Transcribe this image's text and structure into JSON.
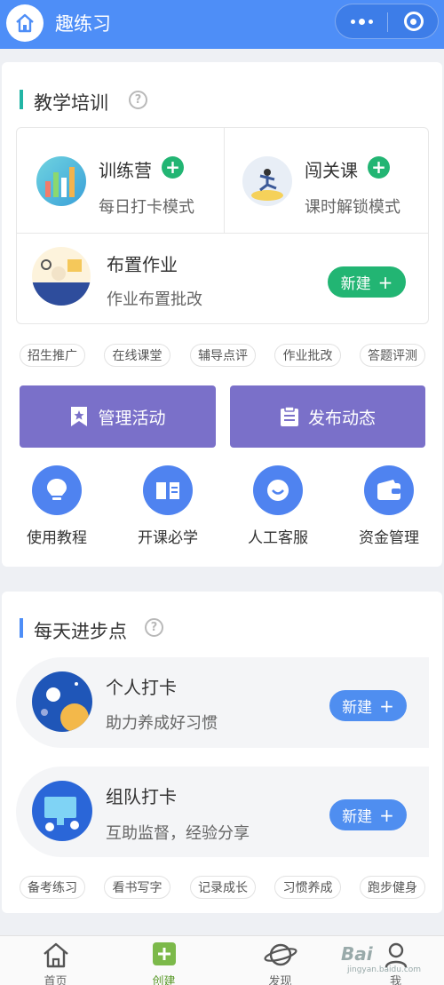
{
  "header": {
    "title": "趣练习"
  },
  "teaching": {
    "title": "教学培训",
    "help": "?",
    "camp": {
      "title": "训练营",
      "sub": "每日打卡模式"
    },
    "course": {
      "title": "闯关课",
      "sub": "课时解锁模式"
    },
    "homework": {
      "title": "布置作业",
      "sub": "作业布置批改",
      "button": "新建"
    },
    "tags": [
      "招生推广",
      "在线课堂",
      "辅导点评",
      "作业批改",
      "答题评测"
    ],
    "manage_label": "管理活动",
    "publish_label": "发布动态",
    "tools": [
      "使用教程",
      "开课必学",
      "人工客服",
      "资金管理"
    ]
  },
  "daily": {
    "title": "每天进步点",
    "help": "?",
    "personal": {
      "title": "个人打卡",
      "sub": "助力养成好习惯",
      "button": "新建"
    },
    "team": {
      "title": "组队打卡",
      "sub": "互助监督，经验分享",
      "button": "新建"
    },
    "tags": [
      "备考练习",
      "看书写字",
      "记录成长",
      "习惯养成",
      "跑步健身"
    ]
  },
  "tabbar": {
    "home": "首页",
    "create": "创建",
    "discover": "发现",
    "me": "我"
  },
  "watermark": {
    "main": "Bai",
    "sub": "jingyan.baidu.com"
  },
  "colors": {
    "primary": "#4e8ef7",
    "green": "#22b573",
    "purple": "#7a70c9",
    "blue_btn": "#4f8ef0"
  }
}
